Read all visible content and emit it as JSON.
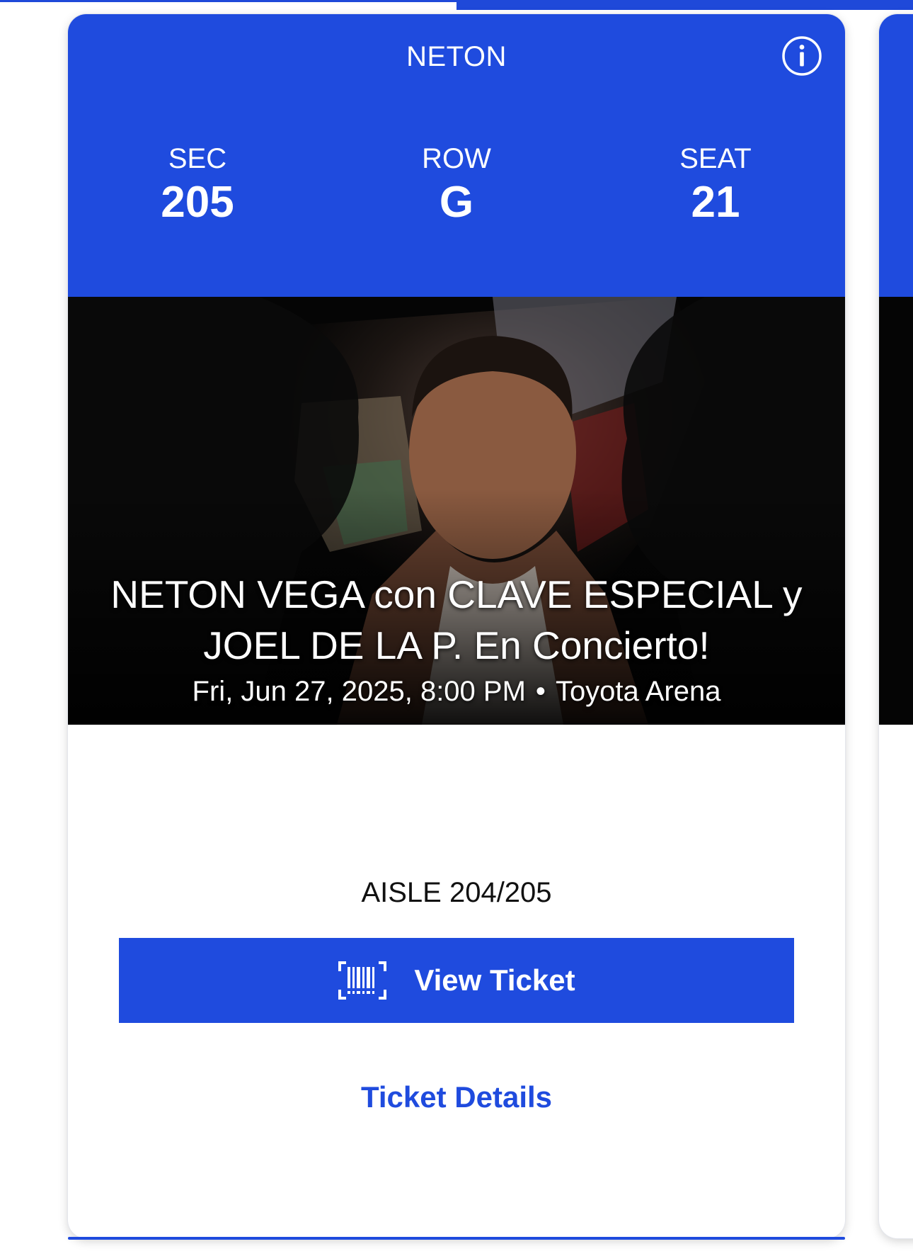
{
  "ticket": {
    "header_title": "NETON",
    "section_label": "SEC",
    "section_value": "205",
    "row_label": "ROW",
    "row_value": "G",
    "seat_label": "SEAT",
    "seat_value": "21",
    "event_title": "NETON VEGA con CLAVE ESPECIAL y JOEL DE LA P. En Concierto!",
    "event_datetime": "Fri, Jun 27, 2025, 8:00 PM",
    "separator": "•",
    "venue": "Toyota Arena",
    "aisle": "AISLE 204/205",
    "view_ticket_label": "View Ticket",
    "ticket_details_label": "Ticket Details"
  },
  "icons": {
    "info": "info-icon",
    "barcode": "barcode-icon"
  },
  "colors": {
    "brand_blue": "#1f4bde",
    "image_background": "#050505",
    "card_background": "#ffffff"
  }
}
